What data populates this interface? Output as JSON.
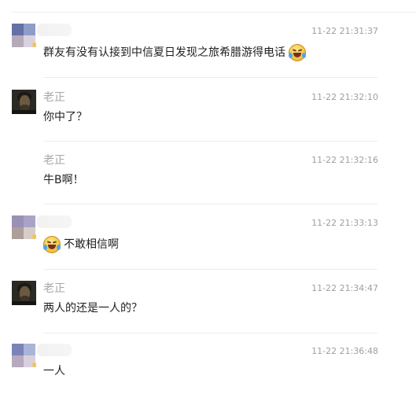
{
  "messages": [
    {
      "name": "",
      "time": "11-22 21:31:37",
      "text": "群友有没有认接到中信夏日发现之旅希腊游得电话",
      "emoji": "laughing-crying-emoji",
      "avatar": "pixelated-avatar"
    },
    {
      "name": "老正",
      "time": "11-22 21:32:10",
      "text": "你中了？",
      "avatar": "dark-portrait-avatar"
    },
    {
      "name": "老正",
      "time": "11-22 21:32:16",
      "text": "牛B啊！",
      "avatar": "none"
    },
    {
      "name": "",
      "time": "11-22 21:33:13",
      "text": "不敢相信啊",
      "emoji": "laughing-crying-emoji",
      "avatar": "pixelated-avatar"
    },
    {
      "name": "老正",
      "time": "11-22 21:34:47",
      "text": "两人的还是一人的？",
      "avatar": "dark-portrait-avatar"
    },
    {
      "name": "",
      "time": "11-22 21:36:48",
      "text": "一人",
      "avatar": "pixelated-avatar"
    }
  ],
  "colors": {
    "timestamp": "#9f9f9f",
    "name": "#a8a8a8",
    "message_text": "#1f1f1f",
    "divider": "#ececec",
    "background": "#ffffff"
  }
}
